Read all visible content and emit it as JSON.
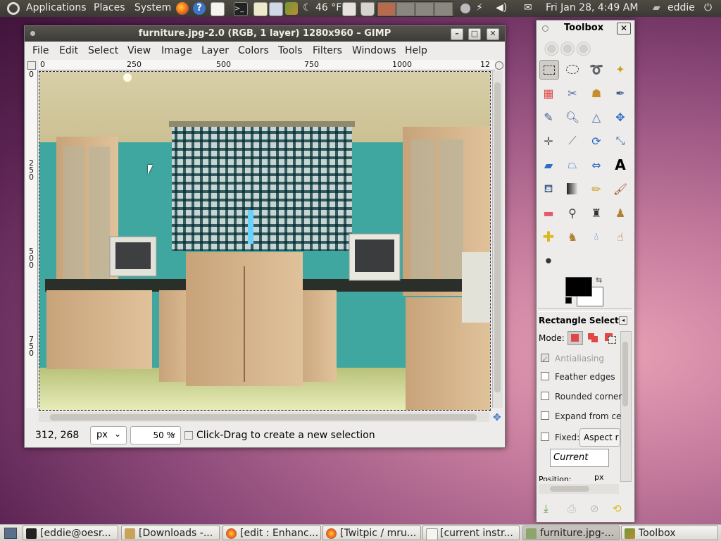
{
  "top_panel": {
    "menus": [
      "Applications",
      "Places",
      "System"
    ],
    "weather": "46 °F",
    "datetime": "Fri Jan 28,  4:49 AM",
    "user": "eddie",
    "icons": [
      "ubuntu-logo-icon",
      "firefox-icon",
      "help-icon",
      "text-editor-icon",
      "terminal-icon",
      "notes-icon",
      "screenshot-icon",
      "gimp-icon",
      "moon-icon",
      "workspace-switcher",
      "trash-icon",
      "network-icon",
      "volume-icon",
      "mail-icon",
      "chat-icon",
      "power-icon"
    ]
  },
  "gimp": {
    "title": "furniture.jpg-2.0 (RGB, 1 layer) 1280x960 – GIMP",
    "menu": [
      "File",
      "Edit",
      "Select",
      "View",
      "Image",
      "Layer",
      "Colors",
      "Tools",
      "Filters",
      "Windows",
      "Help"
    ],
    "ruler_h": [
      "0",
      "250",
      "500",
      "750",
      "1000",
      "12"
    ],
    "ruler_v": [
      "0",
      "2\n5\n0",
      "5\n0\n0",
      "7\n5\n0"
    ],
    "coords": "312, 268",
    "unit": "px",
    "zoom": "50 %",
    "status_message": "Click-Drag to create a new selection"
  },
  "toolbox": {
    "title": "Toolbox",
    "tool_options_title": "Rectangle Select",
    "mode_label": "Mode:",
    "antialiasing": "Antialiasing",
    "feather_edges": "Feather edges",
    "rounded_corners": "Rounded corner",
    "expand_from_center": "Expand from ce",
    "fixed": "Fixed:",
    "fixed_option": "Aspect r",
    "current": "Current",
    "position": "Position:",
    "position_unit": "px",
    "fg_color": "#000000",
    "bg_color": "#ffffff"
  },
  "taskbar": [
    {
      "label": "[eddie@oesr...",
      "icon": "terminal-icon"
    },
    {
      "label": "[Downloads -...",
      "icon": "folder-icon"
    },
    {
      "label": "[edit : Enhanc...",
      "icon": "firefox-icon"
    },
    {
      "label": "[Twitpic / mru...",
      "icon": "firefox-icon"
    },
    {
      "label": "[current instr...",
      "icon": "document-icon"
    },
    {
      "label": "furniture.jpg-...",
      "icon": "gimp-image-icon"
    },
    {
      "label": "Toolbox",
      "icon": "gimp-icon"
    }
  ]
}
